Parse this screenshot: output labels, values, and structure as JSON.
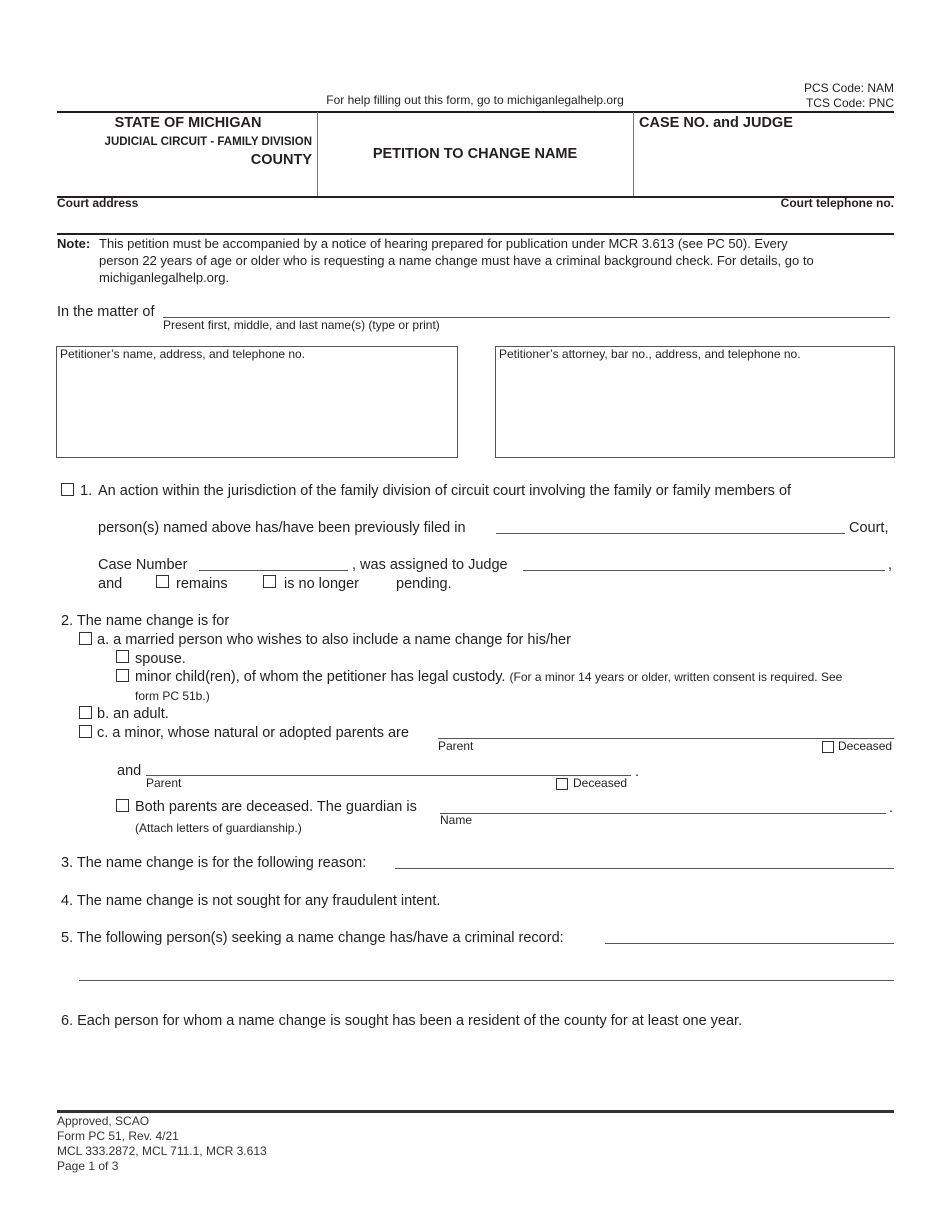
{
  "header": {
    "help_text": "For help filling out this form, go to michiganlegalhelp.org",
    "pcs_code": "PCS Code: NAM",
    "tcs_code": "TCS Code: PNC",
    "state": "STATE OF MICHIGAN",
    "court_division": "JUDICIAL CIRCUIT - FAMILY DIVISION",
    "county": "COUNTY",
    "form_title": "PETITION TO CHANGE NAME",
    "case_no_label": "CASE NO. and JUDGE",
    "court_address_label": "Court address",
    "court_phone_label": "Court telephone no."
  },
  "note": {
    "label": "Note:",
    "line1": "This petition must be accompanied by a notice of hearing prepared for publication under MCR 3.613 (see PC 50). Every",
    "line2": "person 22 years of age or older who is requesting a name change must have a criminal background check. For details, go to",
    "line3": "michiganlegalhelp.org."
  },
  "matter": {
    "label": "In the matter of",
    "caption": "Present first, middle, and last name(s) (type or print)",
    "value": ""
  },
  "petitioner_box": {
    "label": "Petitioner’s name, address, and telephone no.",
    "value": ""
  },
  "attorney_box": {
    "label": "Petitioner’s attorney, bar no., address, and telephone no.",
    "value": ""
  },
  "item1": {
    "number": "1.",
    "line1": "An action within the jurisdiction of the family division of circuit court involving the family or family members of",
    "line2_prefix": "person(s) named above has/have been previously filed in",
    "line2_suffix": "Court,",
    "case_number_label": "Case Number",
    "judge_label": ", was assigned to Judge",
    "comma": ",",
    "and_label": "and",
    "remains_label": "remains",
    "no_longer_label": "is no longer",
    "pending_label": "pending.",
    "court_value": "",
    "case_number_value": "",
    "judge_value": ""
  },
  "item2": {
    "header": "2. The name change is for",
    "a_label": "a. a married person who wishes to also include a name change for his/her",
    "spouse_label": "spouse.",
    "minor_children_label": "minor child(ren), of whom the petitioner has legal custody.",
    "minor_children_note": "(For a minor 14 years or older, written consent is required. See",
    "minor_children_note2": "form PC 51b.)",
    "b_label": "b. an adult.",
    "c_label": "c. a minor, whose natural or adopted parents are",
    "parent_caption": "Parent",
    "deceased_label": "Deceased",
    "and_label": "and",
    "period": ".",
    "both_deceased_label": "Both parents are deceased. The guardian is",
    "attach_note": "(Attach letters of guardianship.)",
    "name_caption": "Name",
    "parent1_value": "",
    "parent2_value": "",
    "guardian_value": ""
  },
  "item3": {
    "label": "3. The name change is for the following reason:",
    "value": ""
  },
  "item4": {
    "label": "4. The name change is not sought for any fraudulent intent."
  },
  "item5": {
    "label": "5. The following person(s) seeking a name change has/have a criminal record:",
    "value": ""
  },
  "item6": {
    "label": "6. Each person for whom a name change is sought has been a resident of the county for at least one year."
  },
  "footer": {
    "approved": "Approved, SCAO",
    "form_rev": "Form PC 51, Rev. 4/21",
    "statutes": "MCL 333.2872, MCL 711.1, MCR 3.613",
    "page": "Page 1 of 3"
  }
}
